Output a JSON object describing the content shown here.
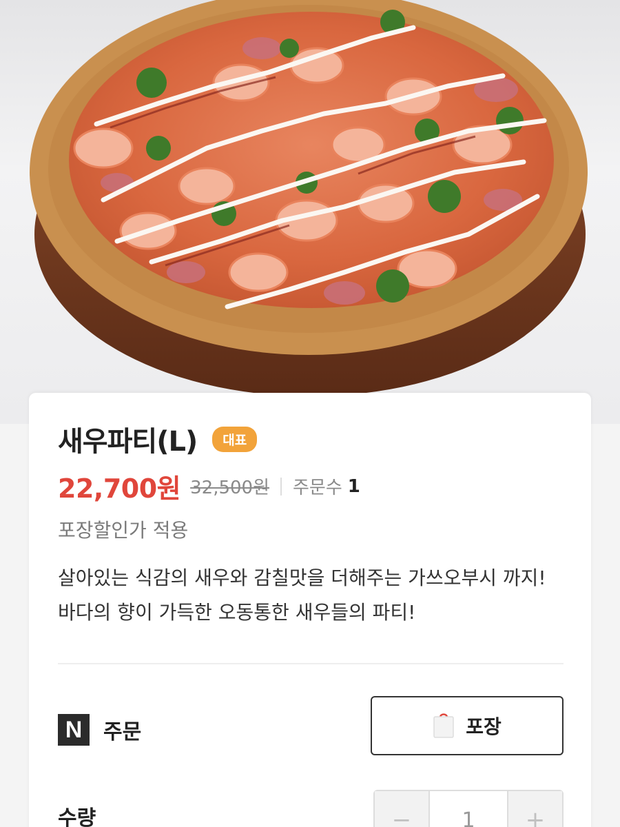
{
  "hero": {
    "image_icon": "pizza-photo"
  },
  "product": {
    "name": "새우파티(L)",
    "badge": "대표",
    "price": "22,700원",
    "original_price": "32,500원",
    "order_count_label": "주문수",
    "order_count": "1",
    "discount_note": "포장할인가 적용",
    "description": "살아있는 식감의 새우와 감칠맛을 더해주는 가쓰오부시 까지! 바다의 향이 가득한 오동통한 새우들의 파티!"
  },
  "order": {
    "logo_letter": "N",
    "label": "주문",
    "pack_button_label": "포장",
    "pack_icon": "shopping-bag-icon"
  },
  "quantity": {
    "label": "수량",
    "value": "1",
    "minus_symbol": "−",
    "plus_symbol": "+"
  },
  "colors": {
    "price": "#e0463b",
    "badge": "#f2a33a",
    "text": "#222222"
  }
}
